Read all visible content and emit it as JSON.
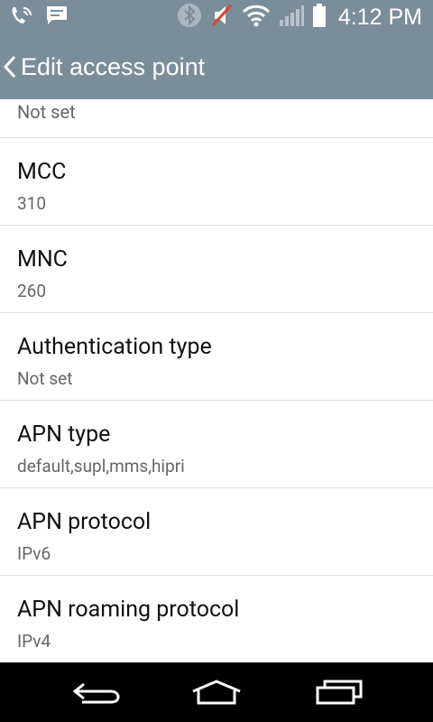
{
  "status_bar": {
    "time": "4:12 PM",
    "icons": [
      "wifi-calling-icon",
      "message-icon",
      "bluetooth-icon",
      "sound-muted-icon",
      "wifi-icon",
      "signal-icon",
      "battery-icon"
    ]
  },
  "header": {
    "title": "Edit access point"
  },
  "list": {
    "partial_value": "Not set",
    "items": [
      {
        "label": "MCC",
        "value": "310"
      },
      {
        "label": "MNC",
        "value": "260"
      },
      {
        "label": "Authentication type",
        "value": "Not set"
      },
      {
        "label": "APN type",
        "value": "default,supl,mms,hipri"
      },
      {
        "label": "APN protocol",
        "value": "IPv6"
      },
      {
        "label": "APN roaming protocol",
        "value": "IPv4"
      }
    ]
  },
  "nav_bar": {
    "buttons": [
      "back-icon",
      "home-icon",
      "recents-icon"
    ]
  }
}
